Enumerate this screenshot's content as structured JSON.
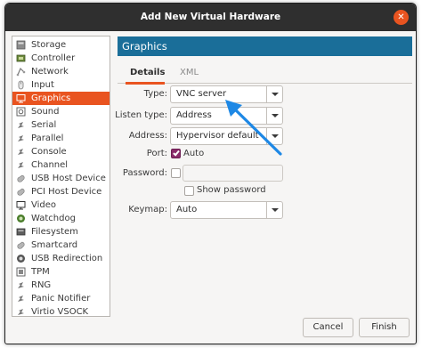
{
  "window": {
    "title": "Add New Virtual Hardware"
  },
  "sidebar": {
    "items": [
      {
        "label": "Storage",
        "icon": "storage-icon"
      },
      {
        "label": "Controller",
        "icon": "controller-icon"
      },
      {
        "label": "Network",
        "icon": "network-icon"
      },
      {
        "label": "Input",
        "icon": "input-icon"
      },
      {
        "label": "Graphics",
        "icon": "graphics-icon",
        "selected": true
      },
      {
        "label": "Sound",
        "icon": "sound-icon"
      },
      {
        "label": "Serial",
        "icon": "serial-icon"
      },
      {
        "label": "Parallel",
        "icon": "parallel-icon"
      },
      {
        "label": "Console",
        "icon": "console-icon"
      },
      {
        "label": "Channel",
        "icon": "channel-icon"
      },
      {
        "label": "USB Host Device",
        "icon": "usb-host-device-icon"
      },
      {
        "label": "PCI Host Device",
        "icon": "pci-host-device-icon"
      },
      {
        "label": "Video",
        "icon": "video-icon"
      },
      {
        "label": "Watchdog",
        "icon": "watchdog-icon"
      },
      {
        "label": "Filesystem",
        "icon": "filesystem-icon"
      },
      {
        "label": "Smartcard",
        "icon": "smartcard-icon"
      },
      {
        "label": "USB Redirection",
        "icon": "usb-redirection-icon"
      },
      {
        "label": "TPM",
        "icon": "tpm-icon"
      },
      {
        "label": "RNG",
        "icon": "rng-icon"
      },
      {
        "label": "Panic Notifier",
        "icon": "panic-notifier-icon"
      },
      {
        "label": "Virtio VSOCK",
        "icon": "virtio-vsock-icon"
      }
    ]
  },
  "panel": {
    "title": "Graphics",
    "tabs": [
      {
        "label": "Details",
        "active": true
      },
      {
        "label": "XML",
        "active": false
      }
    ],
    "form": {
      "type": {
        "label": "Type:",
        "value": "VNC server"
      },
      "listen_type": {
        "label": "Listen type:",
        "value": "Address"
      },
      "address": {
        "label": "Address:",
        "value": "Hypervisor default"
      },
      "port": {
        "label": "Port:",
        "auto_label": "Auto",
        "auto_checked": true
      },
      "password": {
        "label": "Password:",
        "checked": false,
        "value": "",
        "show_password_label": "Show password",
        "show_password_checked": false
      },
      "keymap": {
        "label": "Keymap:",
        "value": "Auto"
      }
    }
  },
  "buttons": {
    "cancel": "Cancel",
    "finish": "Finish"
  },
  "colors": {
    "accent": "#e95420",
    "header": "#1a6e99",
    "annotation_arrow": "#1e88e5",
    "checkbox_checked": "#8a2b6a"
  }
}
